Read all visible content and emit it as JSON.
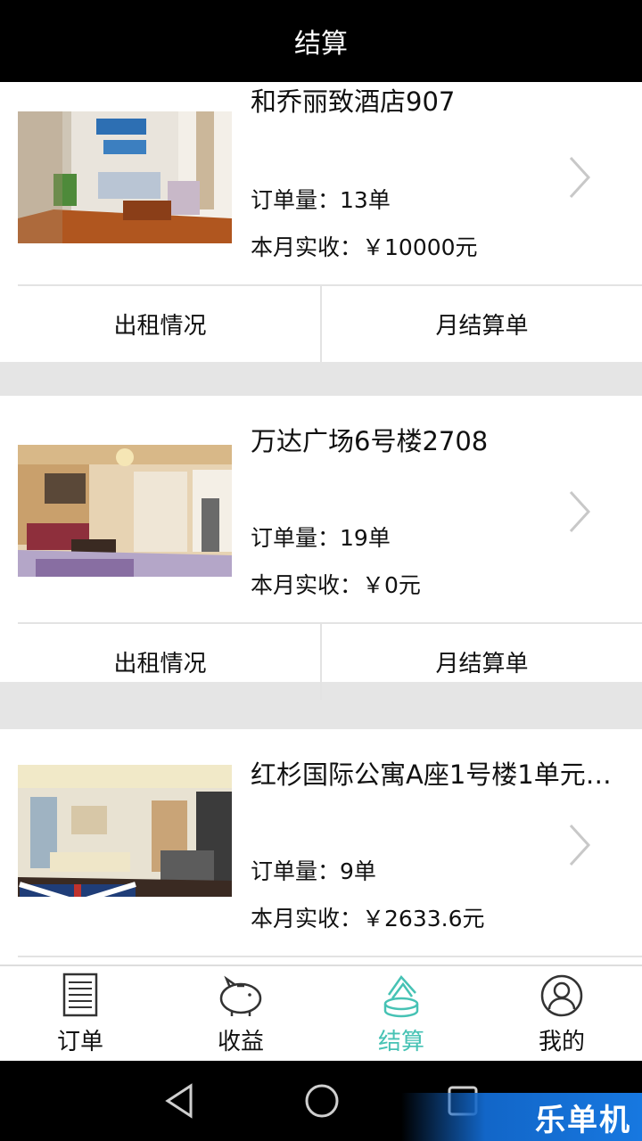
{
  "header": {
    "title": "结算"
  },
  "properties": [
    {
      "name": "和乔丽致酒店907",
      "orders_label": "订单量：",
      "orders_value": "13单",
      "income_label": "本月实收：",
      "income_value": "￥10000元",
      "action_rental": "出租情况",
      "action_statement": "月结算单",
      "image": "living-room-photo"
    },
    {
      "name": "万达广场6号楼2708",
      "orders_label": "订单量：",
      "orders_value": "19单",
      "income_label": "本月实收：",
      "income_value": "￥0元",
      "action_rental": "出租情况",
      "action_statement": "月结算单",
      "image": "living-room-photo"
    },
    {
      "name": "红杉国际公寓A座1号楼1单元1...",
      "orders_label": "订单量：",
      "orders_value": "9单",
      "income_label": "本月实收：",
      "income_value": "￥2633.6元",
      "action_rental": "出租情况",
      "action_statement": "月结算单",
      "image": "living-room-photo"
    }
  ],
  "tabbar": {
    "active_color": "#46c2b4",
    "tabs": [
      {
        "label": "订单",
        "icon": "document-icon"
      },
      {
        "label": "收益",
        "icon": "piggy-bank-icon"
      },
      {
        "label": "结算",
        "icon": "coins-stack-icon"
      },
      {
        "label": "我的",
        "icon": "user-circle-icon"
      }
    ]
  },
  "watermark": {
    "text": "乐单机"
  }
}
